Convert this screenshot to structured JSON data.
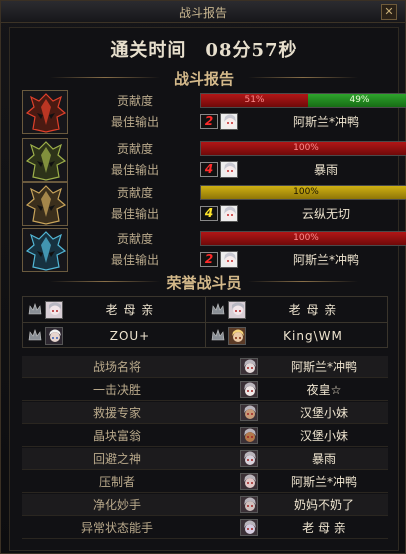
{
  "window": {
    "title": "战斗报告"
  },
  "summary": {
    "clear_time": "通关时间　08分57秒"
  },
  "report": {
    "heading": "战斗报告",
    "rows": [
      {
        "boss_icon": "red-spiked-helmet-icon",
        "contribution_label": "贡献度",
        "best_output_label": "最佳输出",
        "bar": [
          {
            "text": "51%",
            "value": 51,
            "color": "#b21616"
          },
          {
            "text": "49%",
            "value": 49,
            "color": "#2ea42c"
          }
        ],
        "rank": "2",
        "rank_color": "#ff2a2a",
        "player": "阿斯兰*冲鸭"
      },
      {
        "boss_icon": "green-spiked-helmet-icon",
        "contribution_label": "贡献度",
        "best_output_label": "最佳输出",
        "bar": [
          {
            "text": "100%",
            "value": 100,
            "color": "#b21616"
          }
        ],
        "rank": "4",
        "rank_color": "#ff2a2a",
        "player": "暴雨"
      },
      {
        "boss_icon": "gold-spiked-helmet-icon",
        "contribution_label": "贡献度",
        "best_output_label": "最佳输出",
        "bar": [
          {
            "text": "100%",
            "value": 100,
            "color": "#cfb113"
          }
        ],
        "rank": "4",
        "rank_color": "#ffe52a",
        "player": "云纵无切"
      },
      {
        "boss_icon": "blue-spiked-helmet-icon",
        "contribution_label": "贡献度",
        "best_output_label": "最佳输出",
        "bar": [
          {
            "text": "100%",
            "value": 100,
            "color": "#b21616"
          }
        ],
        "rank": "2",
        "rank_color": "#ff2a2a",
        "player": "阿斯兰*冲鸭"
      }
    ]
  },
  "honor": {
    "heading": "荣誉战斗员",
    "members": [
      {
        "name": "老 母 亲",
        "crown_icon": "crown-icon"
      },
      {
        "name": "老 母 亲",
        "crown_icon": "crown-icon"
      },
      {
        "name": "ZOU+",
        "crown_icon": "crown-icon"
      },
      {
        "name": "King\\WM",
        "crown_icon": "crown-icon"
      }
    ]
  },
  "awards": [
    {
      "title": "战场名将",
      "player": "阿斯兰*冲鸭"
    },
    {
      "title": "一击决胜",
      "player": "夜皇☆"
    },
    {
      "title": "救援专家",
      "player": "汉堡小妹"
    },
    {
      "title": "晶块富翁",
      "player": "汉堡小妹"
    },
    {
      "title": "回避之神",
      "player": "暴雨"
    },
    {
      "title": "压制者",
      "player": "阿斯兰*冲鸭"
    },
    {
      "title": "净化妙手",
      "player": "奶妈不奶了"
    },
    {
      "title": "异常状态能手",
      "player": "老 母 亲"
    }
  ]
}
